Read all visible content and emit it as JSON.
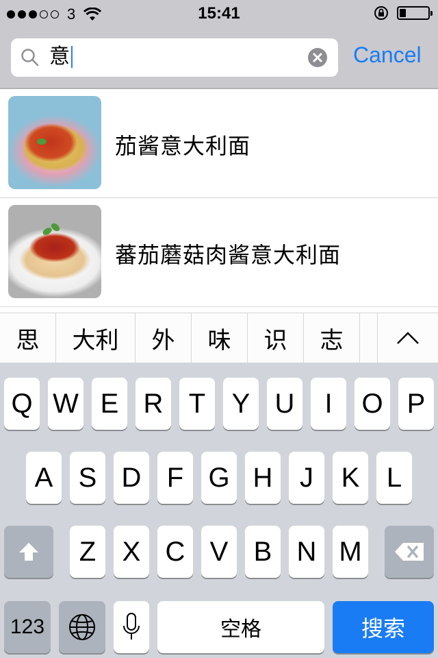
{
  "status_bar": {
    "carrier": "3",
    "time": "15:41",
    "signal_filled": 3,
    "signal_total": 5,
    "battery_level": 0.22
  },
  "search": {
    "query": "意",
    "cancel_label": "Cancel"
  },
  "results": [
    {
      "title": "茄酱意大利面"
    },
    {
      "title": "蕃茄蘑菇肉酱意大利面"
    }
  ],
  "candidates": [
    "思",
    "大利",
    "外",
    "味",
    "识",
    "志"
  ],
  "keyboard": {
    "row1": [
      "Q",
      "W",
      "E",
      "R",
      "T",
      "Y",
      "U",
      "I",
      "O",
      "P"
    ],
    "row2": [
      "A",
      "S",
      "D",
      "F",
      "G",
      "H",
      "J",
      "K",
      "L"
    ],
    "row3": [
      "Z",
      "X",
      "C",
      "V",
      "B",
      "N",
      "M"
    ],
    "numbers_label": "123",
    "space_label": "空格",
    "search_label": "搜索"
  },
  "colors": {
    "accent": "#1a7cf4",
    "header_bg": "#c9c9ce",
    "keyboard_bg": "#d1d5db"
  }
}
